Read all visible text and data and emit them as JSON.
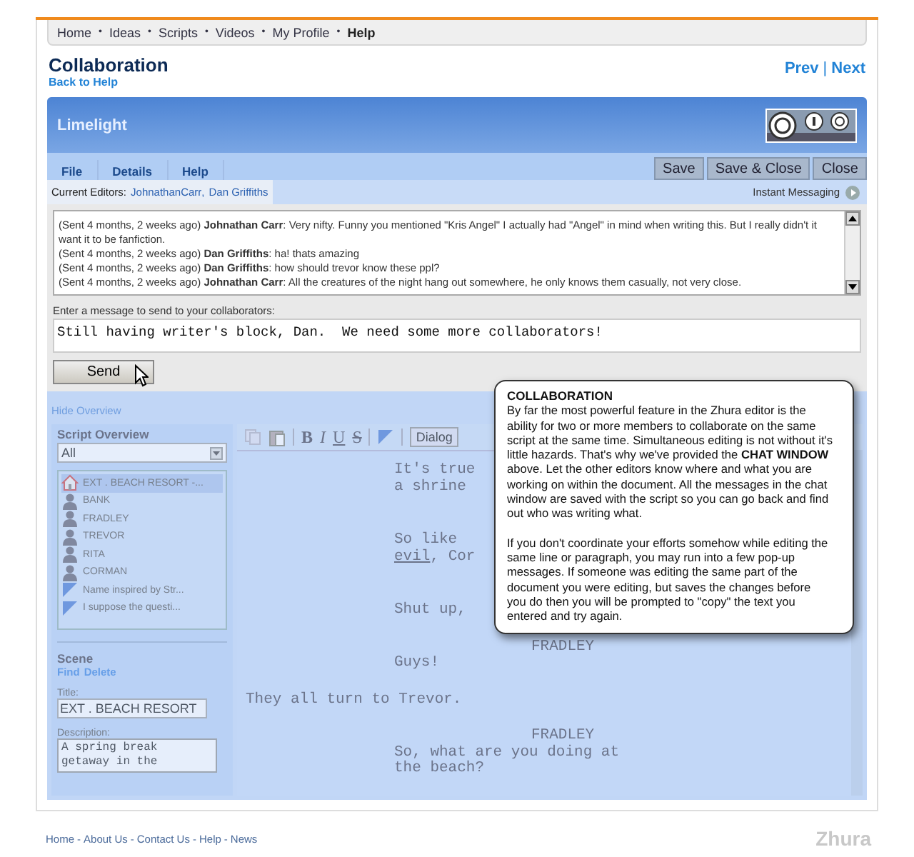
{
  "nav": {
    "items": [
      {
        "label": "Home",
        "selected": false
      },
      {
        "label": "Ideas",
        "selected": false
      },
      {
        "label": "Scripts",
        "selected": false
      },
      {
        "label": "Videos",
        "selected": false
      },
      {
        "label": "My Profile",
        "selected": false
      },
      {
        "label": "Help",
        "selected": true
      }
    ],
    "separator": "•"
  },
  "page": {
    "title": "Collaboration",
    "back_link": "Back to Help",
    "prev": "Prev",
    "separator": "|",
    "next": "Next"
  },
  "app": {
    "name": "Limelight",
    "menu_tabs": [
      "File",
      "Details",
      "Help"
    ],
    "buttons": [
      "Save",
      "Save & Close",
      "Close"
    ],
    "editors_label": "Current Editors:",
    "editors": [
      "JohnathanCarr",
      "Dan Griffiths"
    ],
    "editors_separator": ",",
    "instant_messaging": "Instant Messaging"
  },
  "chat": {
    "messages": [
      {
        "time": "(Sent 4 months, 2 weeks ago)",
        "author": "Johnathan Carr",
        "text": "Very nifty. Funny you mentioned \"Kris Angel\" I actually had \"Angel\" in mind when writing this. But I really didn't it want it to be fanfiction."
      },
      {
        "time": "(Sent 4 months, 2 weeks ago)",
        "author": "Dan Griffiths",
        "text": "ha! thats amazing"
      },
      {
        "time": "(Sent 4 months, 2 weeks ago)",
        "author": "Dan Griffiths",
        "text": "how should trevor know these ppl?"
      },
      {
        "time": "(Sent 4 months, 2 weeks ago)",
        "author": "Johnathan Carr",
        "text": "All the creatures of the night hang out somewhere, he only knows them casually, not very close."
      }
    ],
    "author_separator": ":",
    "prompt": "Enter a message to send to your collaborators:",
    "value": "Still having writer's block, Dan.  We need some more collaborators!",
    "send": "Send"
  },
  "overview": {
    "toggle": "Hide Overview",
    "title": "Script Overview",
    "filter": "All",
    "items": [
      {
        "kind": "scene",
        "label": "EXT . BEACH RESORT -...",
        "selected": true
      },
      {
        "kind": "character",
        "label": "BANK",
        "selected": false
      },
      {
        "kind": "character",
        "label": "FRADLEY",
        "selected": false
      },
      {
        "kind": "character",
        "label": "TREVOR",
        "selected": false
      },
      {
        "kind": "character",
        "label": "RITA",
        "selected": false
      },
      {
        "kind": "character",
        "label": "CORMAN",
        "selected": false
      },
      {
        "kind": "note",
        "label": "Name inspired by Str...",
        "selected": false
      },
      {
        "kind": "note",
        "label": "I suppose the questi...",
        "selected": false
      }
    ]
  },
  "scene": {
    "heading": "Scene",
    "links": [
      "Find",
      "Delete"
    ],
    "title_label": "Title:",
    "title_value": "EXT . BEACH RESORT",
    "description_label": "Description:",
    "description_value": "A spring break getaway in the"
  },
  "editor": {
    "toolbar": [
      {
        "kind": "copy"
      },
      {
        "kind": "paste"
      },
      {
        "kind": "bold",
        "label": "B"
      },
      {
        "kind": "italic",
        "label": "I"
      },
      {
        "kind": "underline",
        "label": "U"
      },
      {
        "kind": "strike",
        "label": "S"
      },
      {
        "kind": "note"
      }
    ],
    "style": "Dialog",
    "blocks": [
      {
        "kind": "dialogue",
        "lines": [
          {
            "text": "It's true"
          },
          {
            "text": "a shrine"
          }
        ]
      },
      {
        "kind": "dialogue",
        "lines": [
          {
            "text": "So like"
          },
          {
            "parts": [
              {
                "text": "evil",
                "underline": true
              },
              {
                "text": ", Cor",
                "underline": false
              }
            ]
          }
        ]
      },
      {
        "kind": "dialogue",
        "lines": [
          {
            "text": "Shut up,"
          }
        ]
      },
      {
        "kind": "character",
        "lines": [
          {
            "text": "FRADLEY"
          }
        ]
      },
      {
        "kind": "dialogue",
        "lines": [
          {
            "text": "Guys!"
          }
        ]
      },
      {
        "kind": "action",
        "lines": [
          {
            "text": "They all turn to Trevor."
          }
        ]
      },
      {
        "kind": "character",
        "lines": [
          {
            "text": "FRADLEY"
          }
        ]
      },
      {
        "kind": "dialogue",
        "lines": [
          {
            "text": "So, what are you doing at"
          },
          {
            "text": "the beach?"
          }
        ]
      }
    ]
  },
  "help_popup": {
    "title": "COLLABORATION",
    "paragraphs": [
      "By far the most powerful feature in the Zhura editor is the ability for two or more members to collaborate on the same script at the same time. Simultaneous editing is not without it's little hazards.  That's why we've provided the **CHAT WINDOW** above. Let the other editors know where and what you are working on within the document. All the messages in the chat window are saved with the script so you can go back and find out who was writing what.",
      "If you don't coordinate your efforts somehow while editing the same line or paragraph, you may run into a few pop-up messages.  If someone was editing the same part of the document you were editing, but saves the changes before you do then you will be prompted to \"copy\" the text you entered and try again."
    ]
  },
  "footer": {
    "links": [
      "Home",
      "About Us",
      "Contact Us",
      "Help",
      "News"
    ],
    "separator": "-",
    "logo": "Zhura"
  }
}
